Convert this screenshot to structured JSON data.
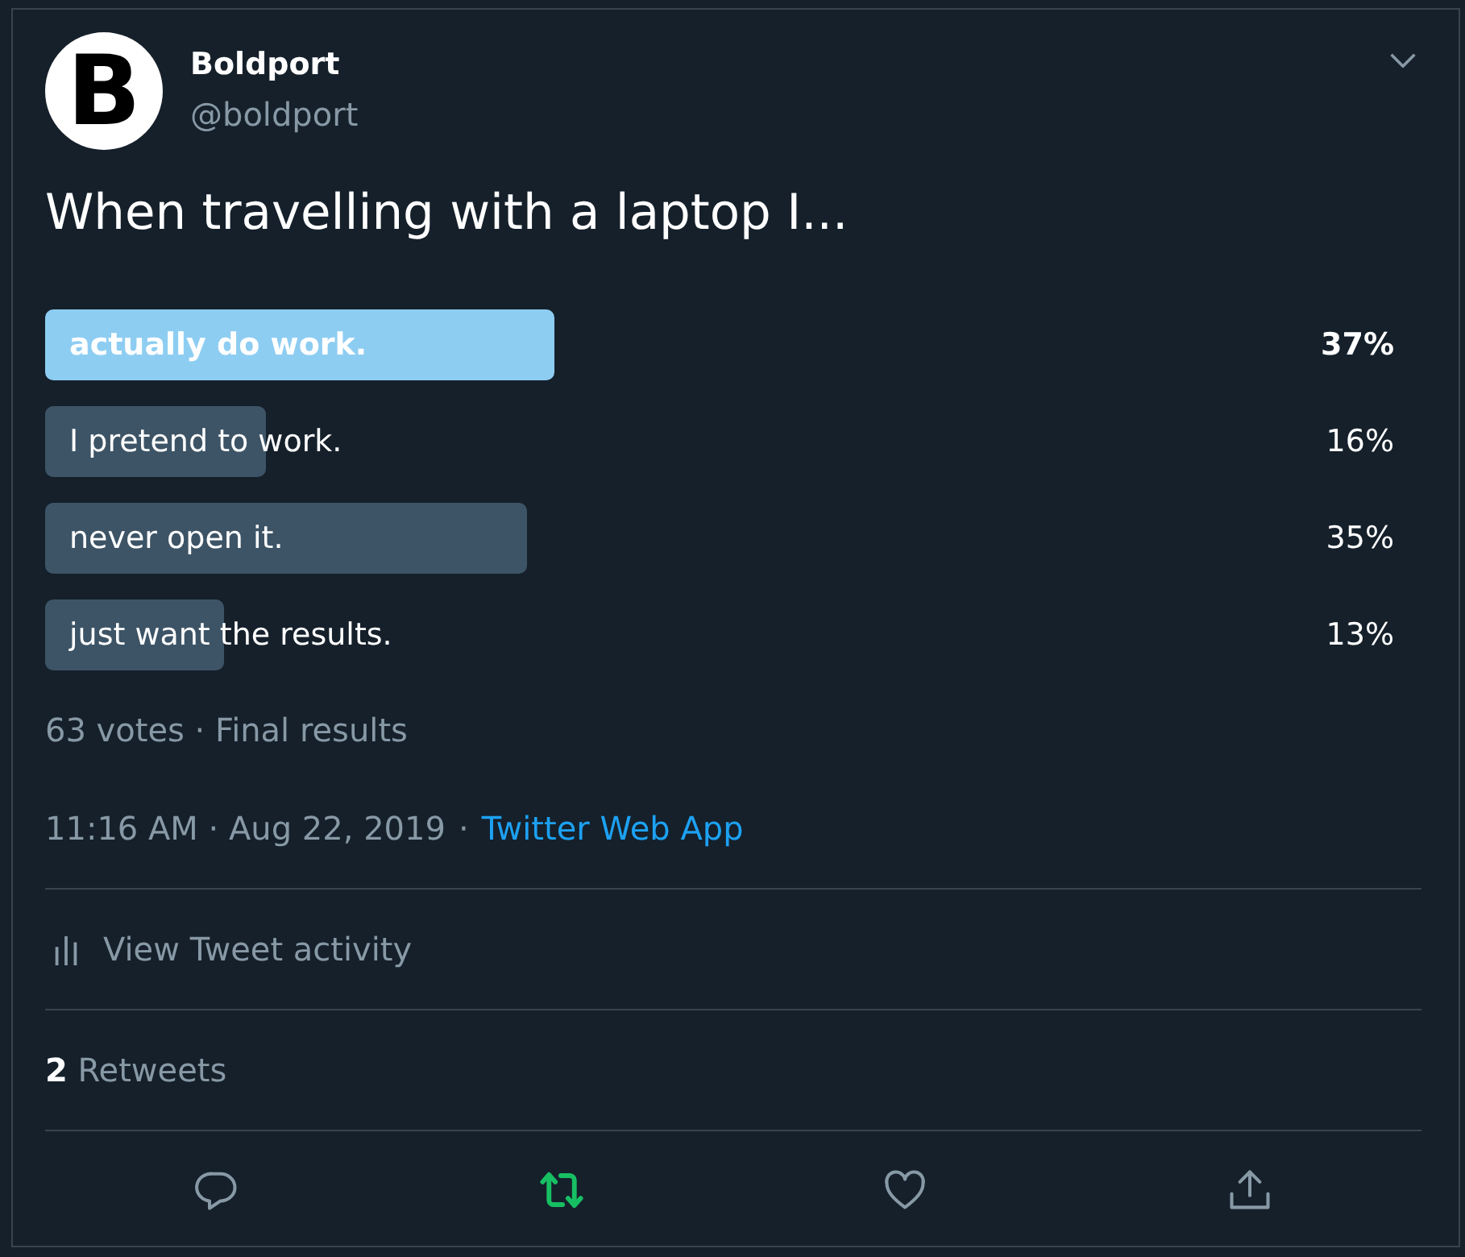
{
  "author": {
    "avatar_letter": "B",
    "name": "Boldport",
    "handle": "@boldport"
  },
  "tweet": {
    "text": "When travelling with a laptop I..."
  },
  "poll": {
    "options": [
      {
        "label": "actually do work.",
        "percent": "37%",
        "level": 0.37,
        "leading": true
      },
      {
        "label": "I pretend to work.",
        "percent": "16%",
        "level": 0.16,
        "leading": false
      },
      {
        "label": "never open it.",
        "percent": "35%",
        "level": 0.35,
        "leading": false
      },
      {
        "label": "just want the results.",
        "percent": "13%",
        "level": 0.13,
        "leading": false
      }
    ],
    "summary": "63 votes · Final results"
  },
  "meta": {
    "time": "11:16 AM · Aug 22, 2019",
    "separator": "·",
    "source": "Twitter Web App"
  },
  "activity": {
    "label": "View Tweet activity"
  },
  "stats": {
    "text": "**2** Retweets"
  },
  "actions": [
    {
      "kind": "reply",
      "active": false
    },
    {
      "kind": "retweet",
      "active": true
    },
    {
      "kind": "like",
      "active": false
    },
    {
      "kind": "share",
      "active": false
    }
  ]
}
